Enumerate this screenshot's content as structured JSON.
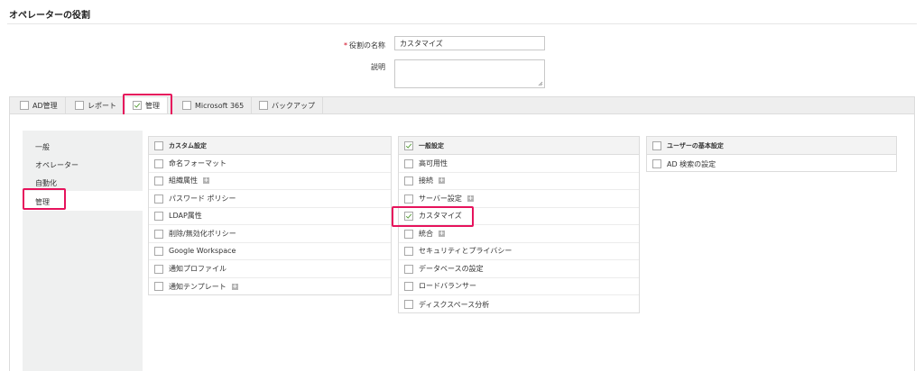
{
  "page": {
    "title": "オペレーターの役割"
  },
  "form": {
    "name_label": "役割の名称",
    "required_mark": "*",
    "name_value": "カスタマイズ",
    "description_label": "説明",
    "description_value": ""
  },
  "tabs": [
    {
      "label": "AD管理",
      "checked": false
    },
    {
      "label": "レポート",
      "checked": false
    },
    {
      "label": "管理",
      "checked": true
    },
    {
      "label": "Microsoft 365",
      "checked": false
    },
    {
      "label": "バックアップ",
      "checked": false
    }
  ],
  "nav": [
    {
      "label": "一般"
    },
    {
      "label": "オペレーター"
    },
    {
      "label": "自動化"
    },
    {
      "label": "管理"
    }
  ],
  "panels": {
    "custom": {
      "header": "カスタム設定",
      "items": [
        "命名フォーマット",
        "組織属性",
        "パスワード ポリシー",
        "LDAP属性",
        "削除/無効化ポリシー",
        "Google Workspace",
        "通知プロファイル",
        "通知テンプレート"
      ]
    },
    "general": {
      "header": "一般設定",
      "items": [
        "高可用性",
        "接続",
        "サーバー設定",
        "カスタマイズ",
        "統合",
        "セキュリティとプライバシー",
        "データベースの設定",
        "ロードバランサー",
        "ディスクスペース分析"
      ]
    },
    "user": {
      "header": "ユーザーの基本設定",
      "items": [
        "AD 検索の設定"
      ]
    }
  },
  "colors": {
    "highlight": "#e6135c",
    "check": "#5aa03c"
  }
}
